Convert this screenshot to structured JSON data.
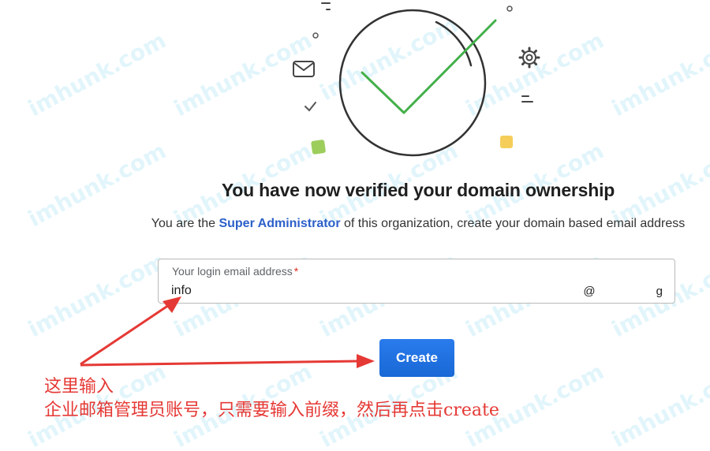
{
  "heading": "You have now verified your domain ownership",
  "subtitle": {
    "prefix": "You are the ",
    "role": "Super Administrator",
    "suffix": " of this organization, create your domain based email address"
  },
  "email_field": {
    "label": "Your login email address",
    "required_marker": "*",
    "value": "info",
    "domain_start": "@",
    "domain_end": "g"
  },
  "create_button": {
    "label": "Create"
  },
  "annotation": {
    "line1": "这里输入",
    "line2": "企业邮箱管理员账号，只需要输入前缀，然后再点击create"
  },
  "watermark": "imhunk.com",
  "colors": {
    "accent": "#2c5fc9",
    "button": "#1a73e8",
    "annotation": "#e53935",
    "checkmark": "#43b04a"
  },
  "icons": {
    "illustration": "verified-check-circle",
    "envelope": "envelope-icon",
    "gear": "gear-icon"
  }
}
